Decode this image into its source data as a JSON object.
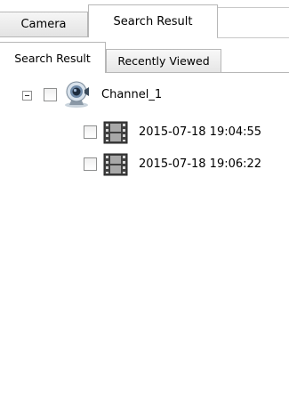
{
  "top_tabs": [
    {
      "label": "Camera",
      "active": false
    },
    {
      "label": "Search Result",
      "active": true
    }
  ],
  "sub_tabs": [
    {
      "label": "Search Result",
      "active": true
    },
    {
      "label": "Recently Viewed",
      "active": false
    }
  ],
  "tree": {
    "channel": {
      "label": "Channel_1",
      "expanded": true,
      "checked": false,
      "icon": "webcam-icon"
    },
    "recordings": [
      {
        "label": "2015-07-18 19:04:55",
        "checked": false,
        "icon": "film-icon"
      },
      {
        "label": "2015-07-18 19:06:22",
        "checked": false,
        "icon": "film-icon"
      }
    ]
  }
}
